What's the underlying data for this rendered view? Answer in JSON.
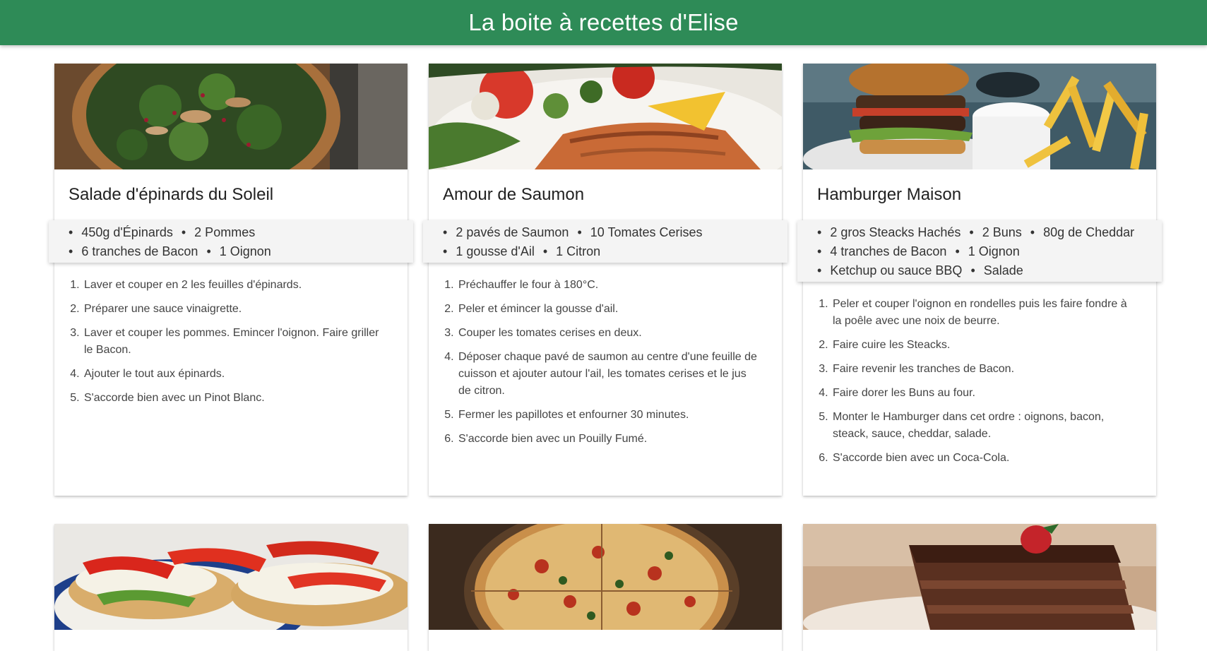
{
  "header": {
    "title": "La boite à recettes d'Elise"
  },
  "recipes": [
    {
      "title": "Salade d'épinards du Soleil",
      "photo": "spinach-salad-photo",
      "ingredients": [
        "450g d'Épinards",
        "2 Pommes",
        "6 tranches de Bacon",
        "1 Oignon"
      ],
      "steps": [
        "Laver et couper en 2 les feuilles d'épinards.",
        "Préparer une sauce vinaigrette.",
        "Laver et couper les pommes. Emincer l'oignon. Faire griller le Bacon.",
        "Ajouter le tout aux épinards.",
        "S'accorde bien avec un Pinot Blanc."
      ]
    },
    {
      "title": "Amour de Saumon",
      "photo": "salmon-photo",
      "ingredients": [
        "2 pavés de Saumon",
        "10 Tomates Cerises",
        "1 gousse d'Ail",
        "1 Citron"
      ],
      "steps": [
        "Préchauffer le four à 180°C.",
        "Peler et émincer la gousse d'ail.",
        "Couper les tomates cerises en deux.",
        "Déposer chaque pavé de saumon au centre d'une feuille de cuisson et ajouter autour l'ail, les tomates cerises et le jus de citron.",
        "Fermer les papillotes et enfourner 30 minutes.",
        "S'accorde bien avec un Pouilly Fumé."
      ]
    },
    {
      "title": "Hamburger Maison",
      "photo": "burger-photo",
      "ingredients": [
        "2 gros Steacks Hachés",
        "2 Buns",
        "80g de Cheddar",
        "4 tranches de Bacon",
        "1 Oignon",
        "Ketchup ou sauce BBQ",
        "Salade"
      ],
      "steps": [
        "Peler et couper l'oignon en rondelles puis les faire fondre à la poêle avec une noix de beurre.",
        "Faire cuire les Steacks.",
        "Faire revenir les tranches de Bacon.",
        "Faire dorer les Buns au four.",
        "Monter le Hamburger dans cet ordre : oignons, bacon, steack, sauce, cheddar, salade.",
        "S'accorde bien avec un Coca-Cola."
      ]
    }
  ],
  "bottom_photos": [
    "tomato-sandwich-photo",
    "pizza-photo",
    "chocolate-cake-photo"
  ],
  "colors": {
    "header": "#2e8b57",
    "ingredients_bg": "#f4f4f4"
  }
}
